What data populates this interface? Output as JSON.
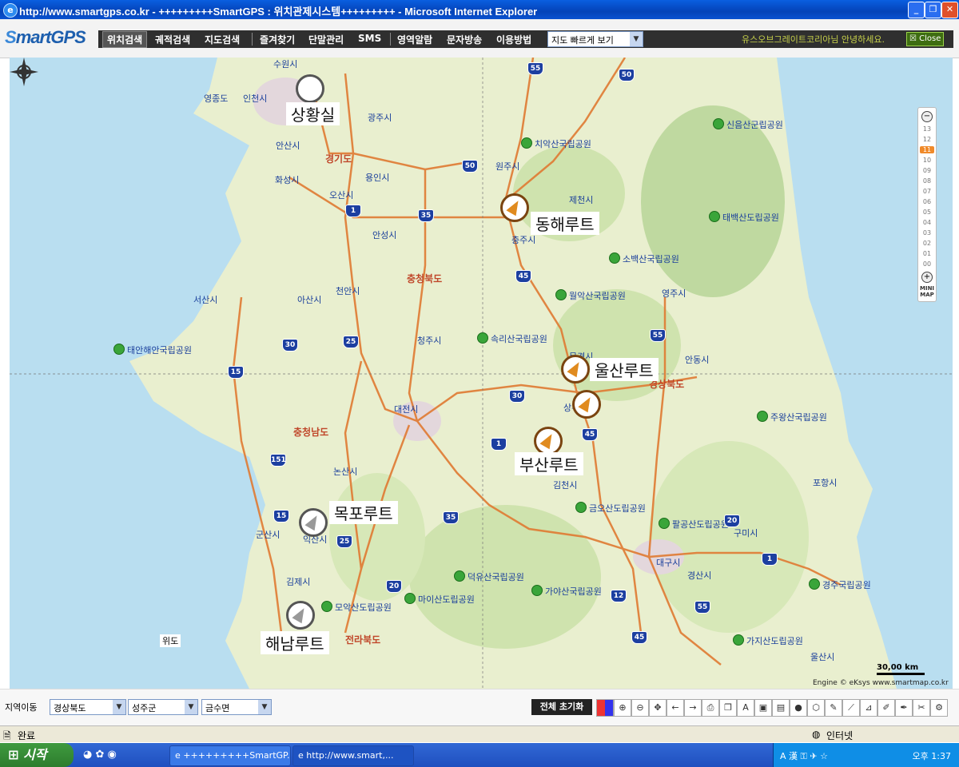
{
  "window": {
    "title": "http://www.smartgps.co.kr - +++++++++SmartGPS : 위치관제시스템+++++++++ - Microsoft Internet Explorer"
  },
  "app": {
    "logo": "martGPS",
    "logo_s": "S",
    "nav": [
      "위치검색",
      "궤적검색",
      "지도검색",
      "즐겨찾기",
      "단말관리",
      "SMS",
      "영역알람",
      "문자방송",
      "이용방법"
    ],
    "quick_view": "지도 빠르게 보기",
    "greeting": "유스오브그레이트코리아님 안녕하세요.",
    "close_label": "Close"
  },
  "map": {
    "routes": [
      {
        "label": "상황실"
      },
      {
        "label": "동해루트"
      },
      {
        "label": "울산루트"
      },
      {
        "label": "부산루트"
      },
      {
        "label": "목포루트"
      },
      {
        "label": "해남루트"
      }
    ],
    "places": [
      "영종도",
      "인천시",
      "광주시",
      "안산시",
      "화성시",
      "용인시",
      "오산시",
      "원주시",
      "제천시",
      "충주시",
      "안성시",
      "천안시",
      "아산시",
      "서산시",
      "청주시",
      "대전시",
      "논산시",
      "군산시",
      "익산시",
      "김제시",
      "김천시",
      "문경시",
      "상주",
      "영주시",
      "안동시",
      "구미시",
      "대구시",
      "경산시",
      "포항시",
      "울산시",
      "위도",
      "수원시"
    ],
    "provinces": [
      "경기도",
      "충청북도",
      "충청남도",
      "경상북도",
      "전라북도"
    ],
    "parks": [
      "치악산국립공원",
      "신음산군립공원",
      "태백산도립공원",
      "소백산국립공원",
      "월악산국립공원",
      "속리산국립공원",
      "태안해안국립공원",
      "주왕산국립공원",
      "금오산도립공원",
      "팔공산도립공원",
      "덕유산국립공원",
      "가야산국립공원",
      "마이산도립공원",
      "모악산도립공원",
      "경주국립공원",
      "가지산도립공원"
    ],
    "highways": [
      "55",
      "50",
      "50",
      "35",
      "1",
      "45",
      "55",
      "30",
      "25",
      "15",
      "30",
      "1",
      "45",
      "151",
      "15",
      "35",
      "25",
      "20",
      "12",
      "55",
      "45",
      "20",
      "1"
    ],
    "zoom_levels": [
      "13",
      "12",
      "11",
      "10",
      "09",
      "08",
      "07",
      "06",
      "05",
      "04",
      "03",
      "02",
      "01",
      "00"
    ],
    "zoom_current": "11",
    "minimap": "MINI MAP",
    "scale": "30,00 km",
    "engine": "Engine © eKsys www.smartmap.co.kr"
  },
  "footer": {
    "region_label": "지역이동",
    "province": "경상북도",
    "county": "성주군",
    "town": "금수면",
    "reset": "전체 초기화"
  },
  "status": {
    "text": "완료",
    "zone": "인터넷"
  },
  "taskbar": {
    "start": "시작",
    "tasks": [
      "+++++++++SmartGP...",
      "http://www.smart,..."
    ],
    "clock": "오후 1:37"
  }
}
